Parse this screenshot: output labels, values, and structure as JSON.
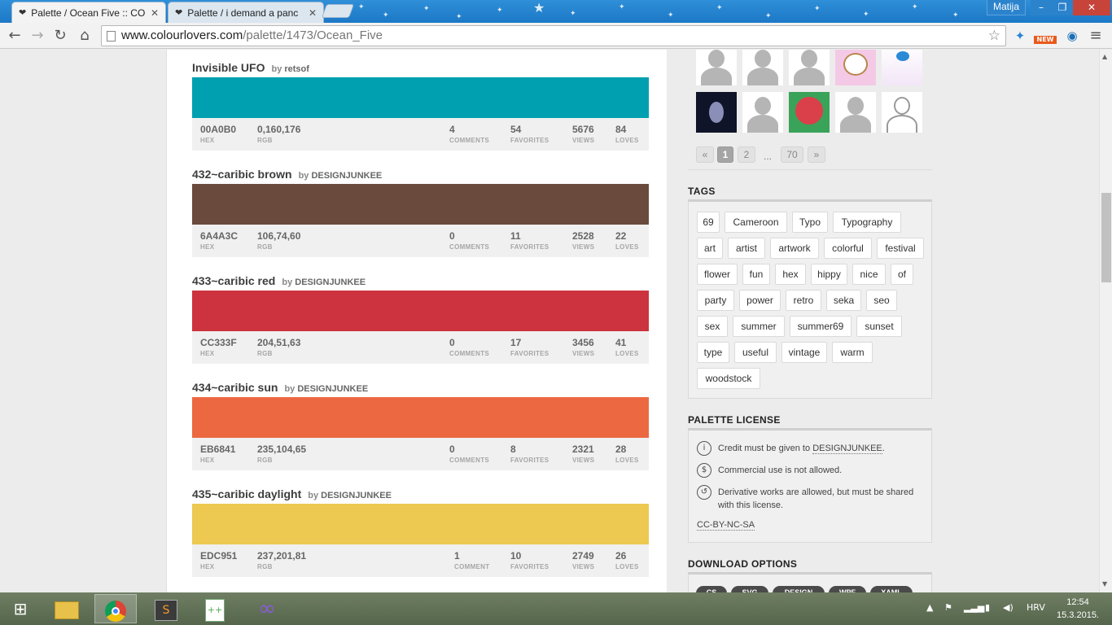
{
  "browser": {
    "tabs": [
      {
        "title": "Palette / Ocean Five :: COL",
        "active": true
      },
      {
        "title": "Palette / i demand a panc",
        "active": false
      }
    ],
    "user": "Matija",
    "url_host": "www.colourlovers.com",
    "url_path": "/palette/1473/Ocean_Five",
    "ext_badge": "NEW"
  },
  "palettes": [
    {
      "name": "Invisible UFO",
      "by": "by",
      "author": "retsof",
      "color": "#00A0B0",
      "hex": "00A0B0",
      "rgb": "0,160,176",
      "comments": "4",
      "comments_label": "COMMENTS",
      "favorites": "54",
      "views": "5676",
      "loves": "84"
    },
    {
      "name": "432~caribic brown",
      "by": "by",
      "author": "DESIGNJUNKEE",
      "color": "#6A4A3C",
      "hex": "6A4A3C",
      "rgb": "106,74,60",
      "comments": "0",
      "comments_label": "COMMENTS",
      "favorites": "11",
      "views": "2528",
      "loves": "22"
    },
    {
      "name": "433~caribic red",
      "by": "by",
      "author": "DESIGNJUNKEE",
      "color": "#CC333F",
      "hex": "CC333F",
      "rgb": "204,51,63",
      "comments": "0",
      "comments_label": "COMMENTS",
      "favorites": "17",
      "views": "3456",
      "loves": "41"
    },
    {
      "name": "434~caribic sun",
      "by": "by",
      "author": "DESIGNJUNKEE",
      "color": "#EB6841",
      "hex": "EB6841",
      "rgb": "235,104,65",
      "comments": "0",
      "comments_label": "COMMENTS",
      "favorites": "8",
      "views": "2321",
      "loves": "28"
    },
    {
      "name": "435~caribic daylight",
      "by": "by",
      "author": "DESIGNJUNKEE",
      "color": "#EDC951",
      "hex": "EDC951",
      "rgb": "237,201,81",
      "comments": "1",
      "comments_label": "COMMENT",
      "favorites": "10",
      "views": "2749",
      "loves": "26"
    }
  ],
  "labels": {
    "hex": "HEX",
    "rgb": "RGB",
    "favorites": "FAVORITES",
    "views": "VIEWS",
    "loves": "LOVES"
  },
  "pagination": {
    "prev": "«",
    "pages": [
      "1",
      "2"
    ],
    "ellipsis": "...",
    "last": "70",
    "next": "»"
  },
  "tags_title": "TAGS",
  "tags": [
    "69",
    "Cameroon",
    "Typo",
    "Typography",
    "art",
    "artist",
    "artwork",
    "colorful",
    "festival",
    "flower",
    "fun",
    "hex",
    "hippy",
    "nice",
    "of",
    "party",
    "power",
    "retro",
    "seka",
    "seo",
    "sex",
    "summer",
    "summer69",
    "sunset",
    "type",
    "useful",
    "vintage",
    "warm",
    "woodstock"
  ],
  "license": {
    "title": "PALETTE LICENSE",
    "credit_prefix": "Credit must be given to",
    "credit_author": "DESIGNJUNKEE",
    "credit_suffix": ".",
    "commercial": "Commercial use is not allowed.",
    "derivative": "Derivative works are allowed, but must be shared with this license.",
    "code": "CC-BY-NC-SA"
  },
  "download": {
    "title": "DOWNLOAD OPTIONS",
    "buttons": [
      "CS",
      "SVG",
      "DESIGN",
      "WPF",
      "XAML"
    ]
  },
  "taskbar": {
    "lang": "HRV",
    "time": "12:54",
    "date": "15.3.2015."
  }
}
